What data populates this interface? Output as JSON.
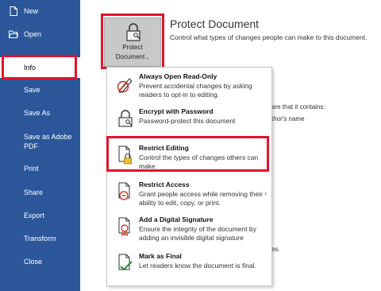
{
  "sidebar": {
    "items": [
      {
        "label": "New",
        "icon": "new-document-icon"
      },
      {
        "label": "Open",
        "icon": "folder-icon"
      },
      {
        "label": "Info"
      },
      {
        "label": "Save"
      },
      {
        "label": "Save As"
      },
      {
        "label": "Save as Adobe PDF"
      },
      {
        "label": "Print"
      },
      {
        "label": "Share"
      },
      {
        "label": "Export"
      },
      {
        "label": "Transform"
      },
      {
        "label": "Close"
      }
    ]
  },
  "protect": {
    "button_line1": "Protect",
    "button_line2": "Document",
    "title": "Protect Document",
    "description": "Control what types of changes people can make to this document."
  },
  "background": {
    "line1": "are that it contains:",
    "line2": "thor's name",
    "line3": "es."
  },
  "menu": {
    "items": [
      {
        "title": "Always Open Read-Only",
        "desc": "Prevent accidental changes by asking readers to opt-in to editing.",
        "icon": "pencil-no-edit-icon"
      },
      {
        "title": "Encrypt with Password",
        "desc": "Password-protect this document",
        "icon": "lock-key-icon"
      },
      {
        "title": "Restrict Editing",
        "desc": "Control the types of changes others can make",
        "icon": "lock-document-icon"
      },
      {
        "title": "Restrict Access",
        "desc": "Grant people access while removing their ability to edit, copy, or print.",
        "icon": "restricted-document-icon"
      },
      {
        "title": "Add a Digital Signature",
        "desc": "Ensure the integrity of the document by adding an invisible digital signature",
        "icon": "signature-ribbon-icon"
      },
      {
        "title": "Mark as Final",
        "desc": "Let readers know the document is final.",
        "icon": "final-document-icon"
      }
    ]
  },
  "colors": {
    "sidebar": "#2b579a",
    "highlight": "#e0142c"
  }
}
